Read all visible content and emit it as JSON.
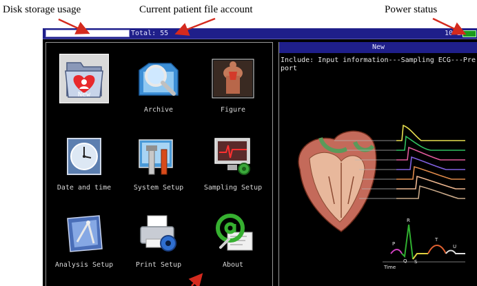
{
  "callouts": {
    "disk": "Disk storage usage",
    "patient": "Current patient file account",
    "power": "Power status"
  },
  "status_bar": {
    "total": "Total: 55",
    "clock": "10 23"
  },
  "menu": {
    "new": "New",
    "archive": "Archive",
    "figure": "Figure",
    "date_time": "Date and time",
    "system_setup": "System Setup",
    "sampling_setup": "Sampling Setup",
    "analysis_setup": "Analysis Setup",
    "print_setup": "Print Setup",
    "about": "About"
  },
  "preview": {
    "header": "New",
    "description": "Include: Input information---Sampling ECG---Preport"
  },
  "ecg_labels": {
    "p": "P",
    "q": "Q",
    "r": "R",
    "s": "S",
    "t": "T",
    "u": "U",
    "time": "Time"
  },
  "colors": {
    "status_bar": "#1f1f8a",
    "screen_background": "#000000",
    "selected_tile": "#d9d9d9",
    "arrow": "#d42a1e",
    "battery": "#1c9b1c"
  }
}
